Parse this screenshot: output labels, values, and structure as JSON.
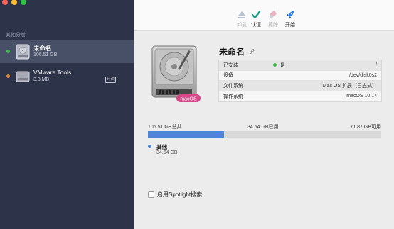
{
  "sidebar": {
    "section_label": "其他分卷",
    "items": [
      {
        "name": "未命名",
        "size": "106.51 GB",
        "dot_color": "#3dc14a",
        "selected": true
      },
      {
        "name": "VMware Tools",
        "size": "3.3 MB",
        "dot_color": "#d9822b",
        "badge": "只读"
      }
    ]
  },
  "toolbar": {
    "unmount": "卸载",
    "verify": "认证",
    "erase": "擦除",
    "start": "开始"
  },
  "volume": {
    "title": "未命名",
    "badge": "macOS",
    "info": [
      {
        "key": "已安装",
        "value": "/",
        "status": "是"
      },
      {
        "key": "设备",
        "value": "/dev/disk0s2"
      },
      {
        "key": "文件系统",
        "value": "Mac OS 扩展（日志式）"
      },
      {
        "key": "操作系统",
        "value": "macOS 10.14"
      }
    ]
  },
  "usage": {
    "total": "106.51 GB总共",
    "used": "34.64 GB已用",
    "free": "71.87 GB可用",
    "used_fraction": 0.3252,
    "legend_name": "其他",
    "legend_size": "34.64 GB",
    "accent_color": "#4d83d9"
  },
  "spotlight": {
    "label": "启用Spotlight搜索",
    "checked": false
  }
}
